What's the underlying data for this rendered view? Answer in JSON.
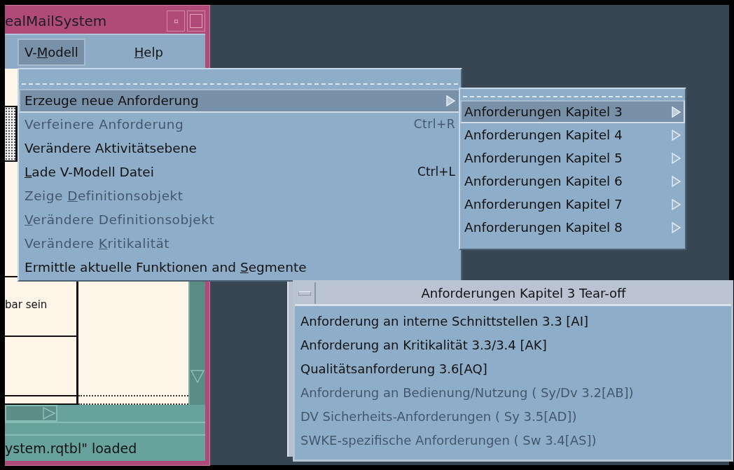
{
  "main_window": {
    "title": "ealMailSystem",
    "menu_bar": [
      {
        "label": {
          "before": "V-",
          "key": "M",
          "after": "odell"
        },
        "selected": true
      },
      {
        "label": {
          "key": "H",
          "after": "elp"
        },
        "selected": false
      }
    ],
    "table_text": "bar sein",
    "status_bar": "ystem.rqtbl\" loaded"
  },
  "menu": {
    "items": [
      {
        "label": "Erzeuge neue Anforderung",
        "disabled": false,
        "selected": true,
        "submenu": true
      },
      {
        "label": "Verfeinere Anforderung",
        "shortcut": "Ctrl+R",
        "disabled": true,
        "selected": false,
        "submenu": false
      },
      {
        "label": "Verändere  Aktivitätsebene",
        "disabled": false,
        "selected": false,
        "submenu": false
      },
      {
        "label": {
          "key": "L",
          "after": "ade V-Modell Datei"
        },
        "shortcut": "Ctrl+L",
        "disabled": false,
        "selected": false,
        "submenu": false
      },
      {
        "label": {
          "before": "Zeige ",
          "key": "D",
          "after": "efinitionsobjekt"
        },
        "disabled": true,
        "selected": false,
        "submenu": false
      },
      {
        "label": {
          "key": "V",
          "after": "erändere  Definitionsobjekt"
        },
        "disabled": true,
        "selected": false,
        "submenu": false
      },
      {
        "label": {
          "before": "Verändere ",
          "key": "K",
          "after": "ritikalität"
        },
        "disabled": true,
        "selected": false,
        "submenu": false
      },
      {
        "label": {
          "before": "Ermittle aktuelle Funktionen and ",
          "key": "S",
          "after": "egmente"
        },
        "disabled": false,
        "selected": false,
        "submenu": false
      }
    ]
  },
  "submenu": {
    "items": [
      {
        "label": "Anforderungen Kapitel 3",
        "selected": true
      },
      {
        "label": "Anforderungen Kapitel 4",
        "selected": false
      },
      {
        "label": "Anforderungen Kapitel 5",
        "selected": false
      },
      {
        "label": "Anforderungen Kapitel 6",
        "selected": false
      },
      {
        "label": "Anforderungen Kapitel 7",
        "selected": false
      },
      {
        "label": "Anforderungen Kapitel 8",
        "selected": false
      }
    ]
  },
  "tearoff": {
    "title": "Anforderungen Kapitel 3 Tear-off",
    "items": [
      {
        "label": "Anforderung an interne Schnittstellen 3.3 [AI]",
        "disabled": false
      },
      {
        "label": "Anforderung an Kritikalität 3.3/3.4 [AK]",
        "disabled": false
      },
      {
        "label": "Qualitätsanforderung 3.6[AQ]",
        "disabled": false
      },
      {
        "label": "Anforderung an Bedienung/Nutzung ( Sy/Dv 3.2[AB])",
        "disabled": true
      },
      {
        "label": "DV Sicherheits-Anforderungen ( Sy 3.5[AD])",
        "disabled": true
      },
      {
        "label": "SWKE-spezifische Anforderungen ( Sw 3.4[AS])",
        "disabled": true
      }
    ]
  }
}
